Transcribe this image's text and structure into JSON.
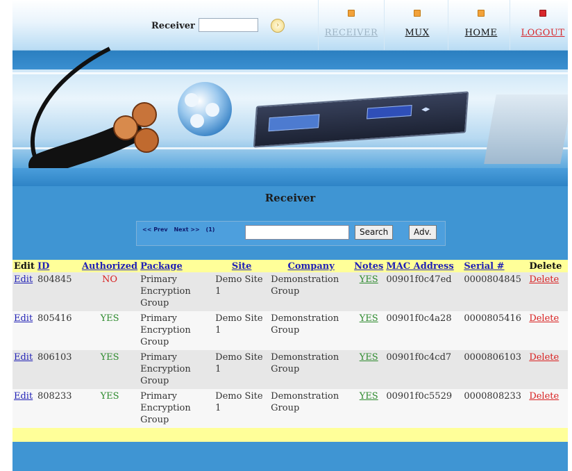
{
  "header": {
    "receiver_label": "Receiver",
    "receiver_input_value": "",
    "go_icon": "arrow-circle-icon",
    "nav": [
      {
        "label": "RECEIVER",
        "icon": "orange-square-icon",
        "state": "disabled"
      },
      {
        "label": "MUX",
        "icon": "orange-square-icon",
        "state": "normal"
      },
      {
        "label": "HOME",
        "icon": "orange-square-icon",
        "state": "normal"
      },
      {
        "label": "LOGOUT",
        "icon": "red-x-icon",
        "state": "logout"
      }
    ]
  },
  "page_title": "Receiver",
  "search": {
    "prev_label": "<< Prev",
    "next_label": "Next >>",
    "count_label": "(1)",
    "input_value": "",
    "search_button": "Search",
    "adv_button": "Adv."
  },
  "table": {
    "headers": {
      "edit": "Edit",
      "id": "ID",
      "authorized": "Authorized",
      "package": "Package",
      "site": "Site",
      "company": "Company",
      "notes": "Notes",
      "mac": "MAC Address",
      "serial": "Serial #",
      "delete": "Delete"
    },
    "rows": [
      {
        "edit": "Edit",
        "id": "804845",
        "authorized": "NO",
        "package": "Primary Encryption Group",
        "site": "Demo Site 1",
        "company": "Demonstration Group",
        "notes": "YES",
        "mac": "00901f0c47ed",
        "serial": "0000804845",
        "delete": "Delete"
      },
      {
        "edit": "Edit",
        "id": "805416",
        "authorized": "YES",
        "package": "Primary Encryption Group",
        "site": "Demo Site 1",
        "company": "Demonstration Group",
        "notes": "YES",
        "mac": "00901f0c4a28",
        "serial": "0000805416",
        "delete": "Delete"
      },
      {
        "edit": "Edit",
        "id": "806103",
        "authorized": "YES",
        "package": "Primary Encryption Group",
        "site": "Demo Site 1",
        "company": "Demonstration Group",
        "notes": "YES",
        "mac": "00901f0c4cd7",
        "serial": "0000806103",
        "delete": "Delete"
      },
      {
        "edit": "Edit",
        "id": "808233",
        "authorized": "YES",
        "package": "Primary Encryption Group",
        "site": "Demo Site 1",
        "company": "Demonstration Group",
        "notes": "YES",
        "mac": "00901f0c5529",
        "serial": "0000808233",
        "delete": "Delete"
      }
    ]
  },
  "colors": {
    "page_blue": "#3f95d3",
    "header_row": "#ffff99",
    "link_blue": "#2121b5",
    "yes_green": "#2d8a2d",
    "no_red": "#d82020"
  }
}
